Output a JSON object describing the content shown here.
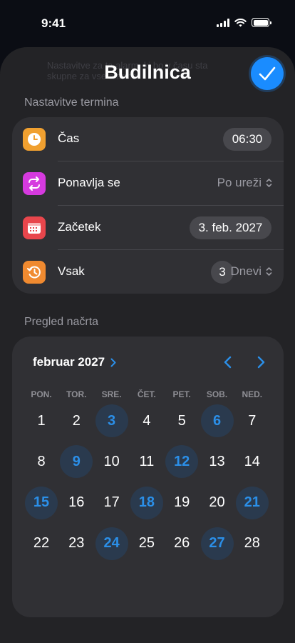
{
  "status_bar": {
    "time": "9:41"
  },
  "sheet": {
    "title": "Budilnica",
    "ghost_line1": "Nastavitve za ta alarm, ki bo v času sta",
    "ghost_line2": "skupne za vse alarme"
  },
  "settings": {
    "header": "Nastavitve termina",
    "time": {
      "label": "Čas",
      "value": "06:30",
      "icon": "clock-icon",
      "color": "#f0a030"
    },
    "repeat": {
      "label": "Ponavlja se",
      "value": "Po ureži",
      "icon": "repeat-icon",
      "color": "#d63adf"
    },
    "start": {
      "label": "Začetek",
      "value": "3. feb. 2027",
      "icon": "calendar-icon",
      "color": "#e8464c"
    },
    "every": {
      "label": "Vsak",
      "count": "3",
      "unit": "Dnevi",
      "icon": "history-icon",
      "color": "#f08a30"
    }
  },
  "calendar": {
    "header": "Pregled načrta",
    "month_label": "februar 2027",
    "accent": "#2b8fe8",
    "weekdays": [
      "PON.",
      "TOR.",
      "SRE.",
      "ČET.",
      "PET.",
      "SOB.",
      "NED."
    ],
    "weeks": [
      [
        "1",
        "2",
        "3",
        "4",
        "5",
        "6",
        "7"
      ],
      [
        "8",
        "9",
        "10",
        "11",
        "12",
        "13",
        "14"
      ],
      [
        "15",
        "16",
        "17",
        "18",
        "19",
        "20",
        "21"
      ],
      [
        "22",
        "23",
        "24",
        "25",
        "26",
        "27",
        "28"
      ]
    ],
    "marked_days": [
      "3",
      "6",
      "9",
      "12",
      "15",
      "18",
      "21",
      "24",
      "27"
    ]
  }
}
